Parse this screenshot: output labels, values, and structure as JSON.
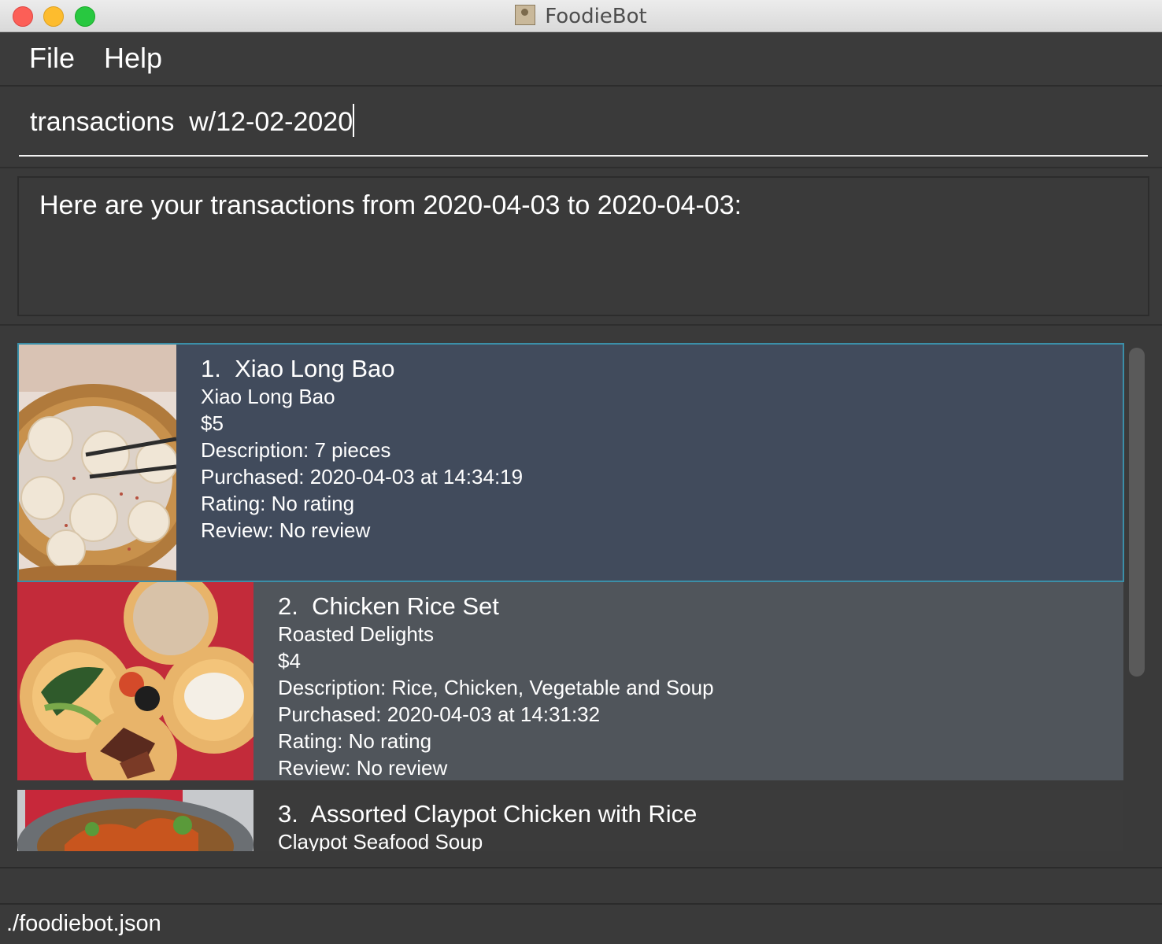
{
  "window": {
    "title": "FoodieBot",
    "app_icon": "contacts-app-icon"
  },
  "menu": {
    "items": [
      "File",
      "Help"
    ]
  },
  "command_box": {
    "value": "transactions  w/12-02-2020"
  },
  "result_display": {
    "text": "Here are your transactions from 2020-04-03 to 2020-04-03:"
  },
  "transactions": [
    {
      "index": "1.",
      "name": "Xiao Long Bao",
      "stall": "Xiao Long Bao",
      "price": "$5",
      "description": "Description: 7 pieces",
      "purchased": "Purchased: 2020-04-03 at 14:34:19",
      "rating": "Rating: No rating",
      "review": "Review: No review",
      "image": "xiao-long-bao-photo",
      "selected": true
    },
    {
      "index": "2.",
      "name": "Chicken Rice Set",
      "stall": "Roasted Delights",
      "price": "$4",
      "description": "Description: Rice, Chicken, Vegetable and Soup",
      "purchased": "Purchased: 2020-04-03 at 14:31:32",
      "rating": "Rating: No rating",
      "review": "Review: No review",
      "image": "chicken-rice-set-photo",
      "selected": false
    },
    {
      "index": "3.",
      "name": "Assorted Claypot Chicken with Rice",
      "stall": "Claypot Seafood Soup",
      "image": "claypot-chicken-photo",
      "selected": false
    }
  ],
  "status_bar": {
    "file_path": "./foodiebot.json"
  },
  "colors": {
    "background": "#3a3a3a",
    "selected_card": "#414b5c",
    "selected_border": "#3b8fa8",
    "card_alt": "#50555b"
  }
}
